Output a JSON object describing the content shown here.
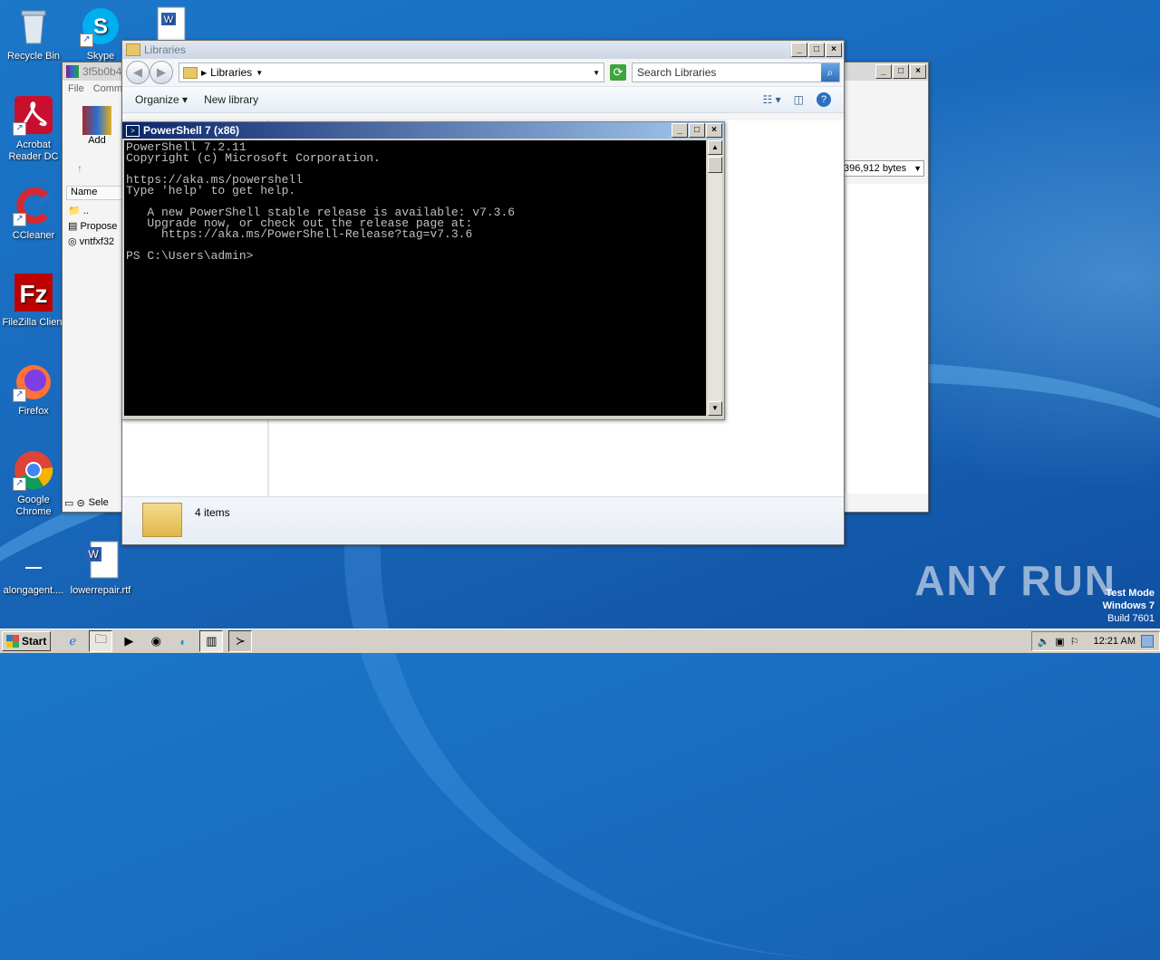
{
  "desktop": {
    "icons": [
      {
        "label": "Recycle Bin"
      },
      {
        "label": "Skype"
      },
      {
        "label": "Acrobat Reader DC"
      },
      {
        "label": "CCleaner"
      },
      {
        "label": "FileZilla Client"
      },
      {
        "label": "Firefox"
      },
      {
        "label": "Google Chrome"
      },
      {
        "label": "alongagent...."
      },
      {
        "label": "lowerrepair.rtf"
      }
    ]
  },
  "back_explorer": {
    "title": "3f5b0b4",
    "menu": [
      "File",
      "Comm"
    ],
    "add_label": "Add",
    "column_name": "Name",
    "files": [
      "..",
      "Propose",
      "vntfxf32"
    ],
    "size_value": "396,912 bytes",
    "status_text": "Sele"
  },
  "libraries": {
    "title": "Libraries",
    "address": "Libraries",
    "search_placeholder": "Search Libraries",
    "toolbar": {
      "organize": "Organize",
      "new_library": "New library"
    },
    "status_count": "4 items"
  },
  "powershell": {
    "title": "PowerShell 7 (x86)",
    "lines": [
      "PowerShell 7.2.11",
      "Copyright (c) Microsoft Corporation.",
      "",
      "https://aka.ms/powershell",
      "Type 'help' to get help.",
      "",
      "   A new PowerShell stable release is available: v7.3.6",
      "   Upgrade now, or check out the release page at:",
      "     https://aka.ms/PowerShell-Release?tag=v7.3.6",
      "",
      "PS C:\\Users\\admin>"
    ]
  },
  "taskbar": {
    "start_label": "Start",
    "clock": "12:21 AM"
  },
  "watermark": {
    "brand": "ANY RUN",
    "test_mode": "Test Mode",
    "os": "Windows 7",
    "build": "Build 7601"
  }
}
